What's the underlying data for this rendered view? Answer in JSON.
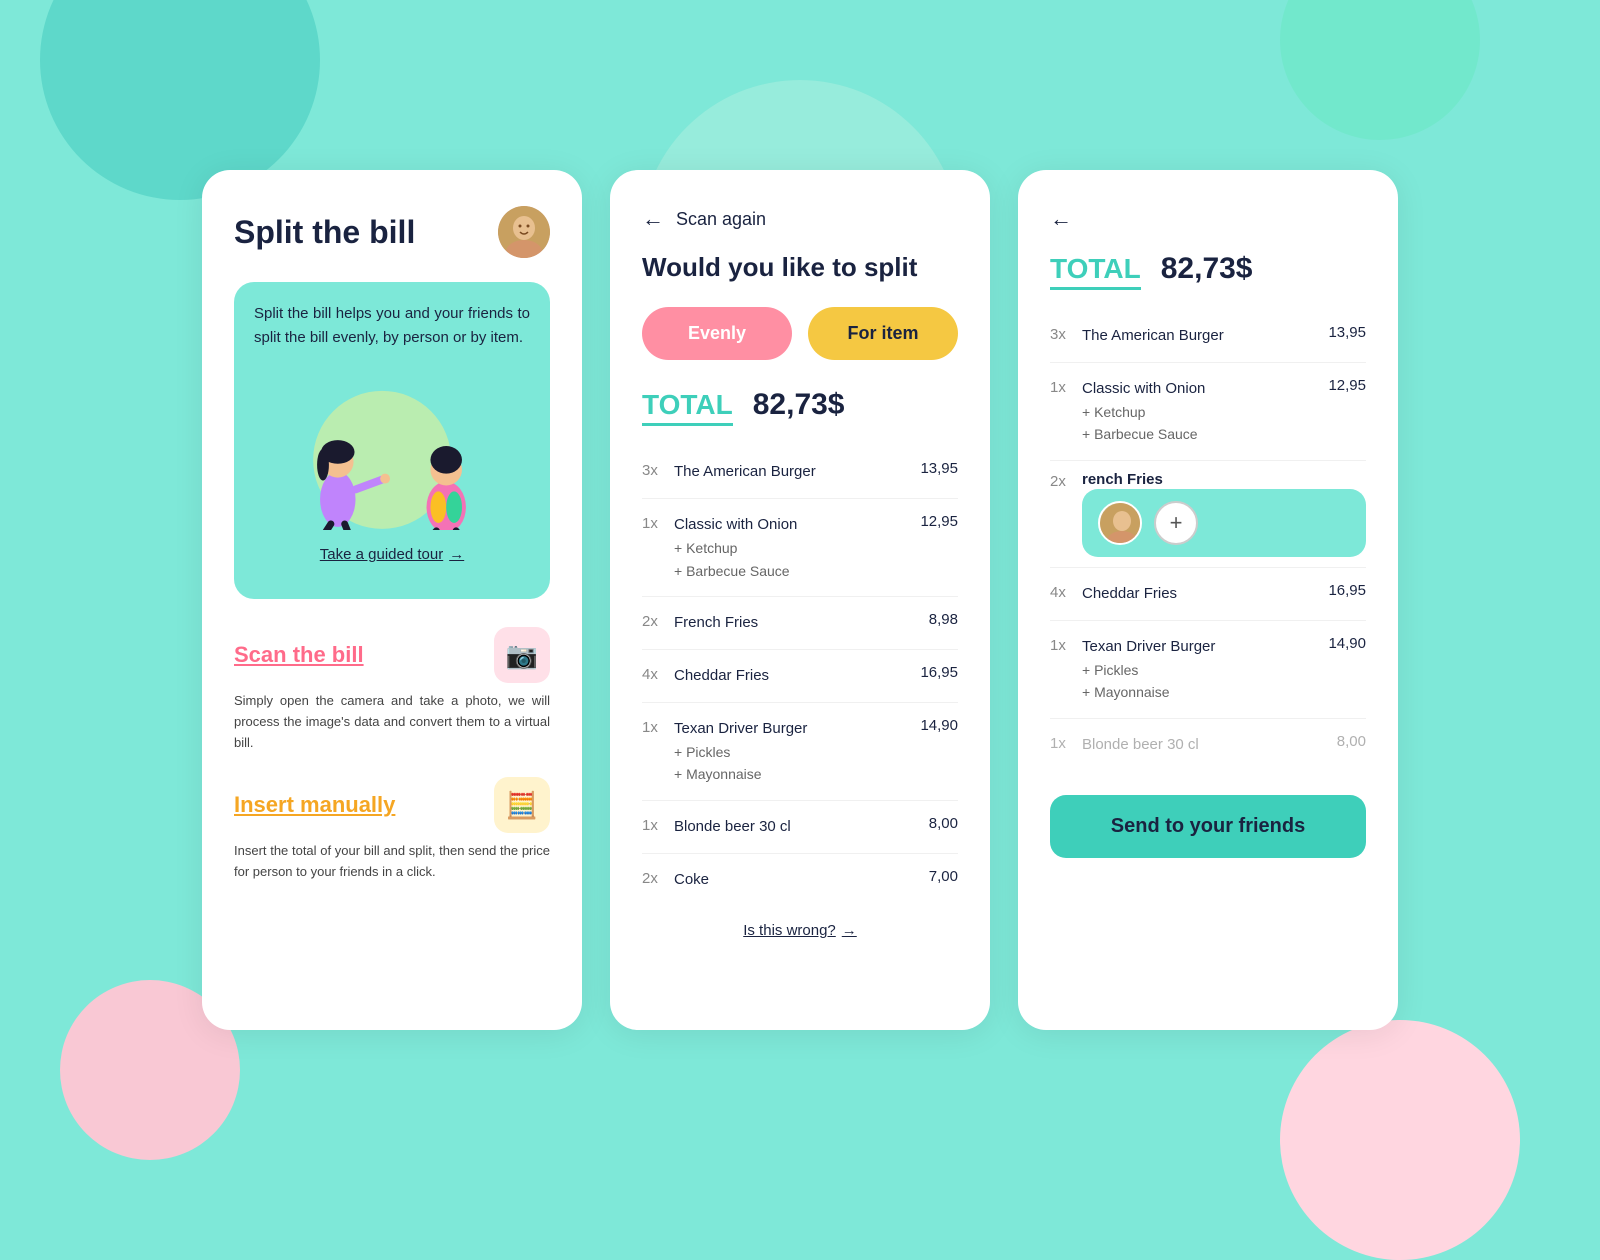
{
  "bg": {
    "circles": [
      {
        "class": "bg-teal-top"
      },
      {
        "class": "bg-green-top"
      },
      {
        "class": "bg-pink-bl"
      },
      {
        "class": "bg-pink-br"
      },
      {
        "class": "bg-green-center"
      }
    ]
  },
  "card1": {
    "title": "Split the bill",
    "hero_text": "Split the bill helps you and your friends to split the bill evenly, by person or by item.",
    "tour_link": "Take a guided tour",
    "scan_title": "Scan the bill",
    "scan_desc": "Simply open the camera and take a photo, we will process the image's data and convert them to a virtual bill.",
    "manual_title": "Insert manually",
    "manual_desc": "Insert the total of your bill and split, then send the price for person to your friends in a click."
  },
  "card2": {
    "back_label": "Scan again",
    "question": "Would you like to split",
    "btn_evenly": "Evenly",
    "btn_foritem": "For item",
    "total_label": "TOTAL",
    "total_amount": "82,73$",
    "items": [
      {
        "qty": "3x",
        "name": "The American Burger",
        "addons": [],
        "price": "13,95"
      },
      {
        "qty": "1x",
        "name": "Classic with Onion",
        "addons": [
          "+ Ketchup",
          "+ Barbecue Sauce"
        ],
        "price": "12,95"
      },
      {
        "qty": "2x",
        "name": "French Fries",
        "addons": [],
        "price": "8,98"
      },
      {
        "qty": "4x",
        "name": "Cheddar Fries",
        "addons": [],
        "price": "16,95"
      },
      {
        "qty": "1x",
        "name": "Texan Driver Burger",
        "addons": [
          "+ Pickles",
          "+ Mayonnaise"
        ],
        "price": "14,90"
      },
      {
        "qty": "1x",
        "name": "Blonde beer 30 cl",
        "addons": [],
        "price": "8,00"
      },
      {
        "qty": "2x",
        "name": "Coke",
        "addons": [],
        "price": "7,00"
      }
    ],
    "wrong_link": "Is this wrong?"
  },
  "card3": {
    "total_label": "TOTAL",
    "total_amount": "82,73$",
    "items": [
      {
        "qty": "3x",
        "name": "The American Burger",
        "addons": [],
        "price": "13,95",
        "muted": false
      },
      {
        "qty": "1x",
        "name": "Classic with Onion",
        "addons": [
          "+ Ketchup",
          "+ Barbecue Sauce"
        ],
        "price": "12,95",
        "muted": false
      },
      {
        "qty": "2x",
        "name": "French Fries",
        "addons": [],
        "price": "",
        "muted": false,
        "highlight": true
      },
      {
        "qty": "4x",
        "name": "Cheddar Fries",
        "addons": [],
        "price": "16,95",
        "muted": false
      },
      {
        "qty": "1x",
        "name": "Texan Driver Burger",
        "addons": [
          "+ Pickles",
          "+ Mayonnaise"
        ],
        "price": "14,90",
        "muted": false
      },
      {
        "qty": "1x",
        "name": "Blonde beer 30 cl",
        "addons": [],
        "price": "8,00",
        "muted": true
      }
    ],
    "send_btn": "Send to your friends"
  }
}
